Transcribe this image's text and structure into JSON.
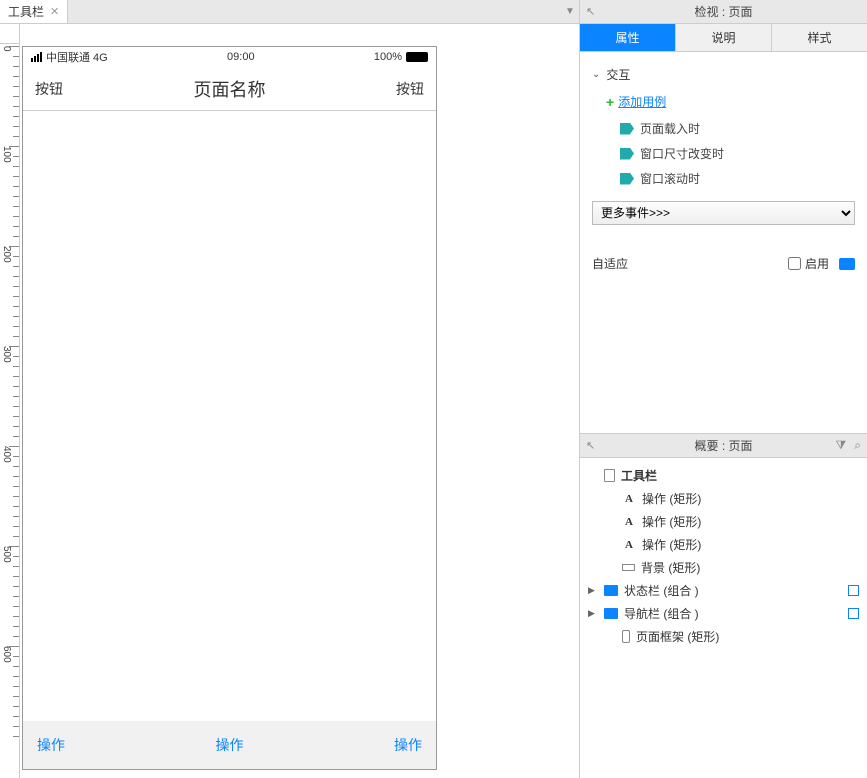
{
  "tabs": {
    "active": "工具栏"
  },
  "ruler": {
    "marks": [
      0,
      100,
      200,
      300,
      400,
      500
    ],
    "vmarks": [
      0,
      100,
      200,
      300,
      400,
      500,
      600
    ]
  },
  "device": {
    "carrier": "中国联通 4G",
    "time": "09:00",
    "battery": "100%",
    "nav_left": "按钮",
    "nav_title": "页面名称",
    "nav_right": "按钮",
    "toolbar": {
      "a1": "操作",
      "a2": "操作",
      "a3": "操作"
    }
  },
  "inspector": {
    "title": "检视 : 页面",
    "tabs": {
      "properties": "属性",
      "notes": "说明",
      "style": "样式"
    },
    "interaction": {
      "header": "交互",
      "add_case": "添加用例",
      "events": [
        "页面载入时",
        "窗口尺寸改变时",
        "窗口滚动时"
      ],
      "more_events": "更多事件>>>"
    },
    "adaptive": {
      "label": "自适应",
      "enable": "启用"
    }
  },
  "outline": {
    "title": "概要 : 页面",
    "root": "工具栏",
    "items": {
      "op1": "操作 (矩形)",
      "op2": "操作 (矩形)",
      "op3": "操作 (矩形)",
      "bg": "背景 (矩形)",
      "status": "状态栏 (组合 )",
      "nav": "导航栏 (组合 )",
      "frame": "页面框架 (矩形)"
    }
  }
}
